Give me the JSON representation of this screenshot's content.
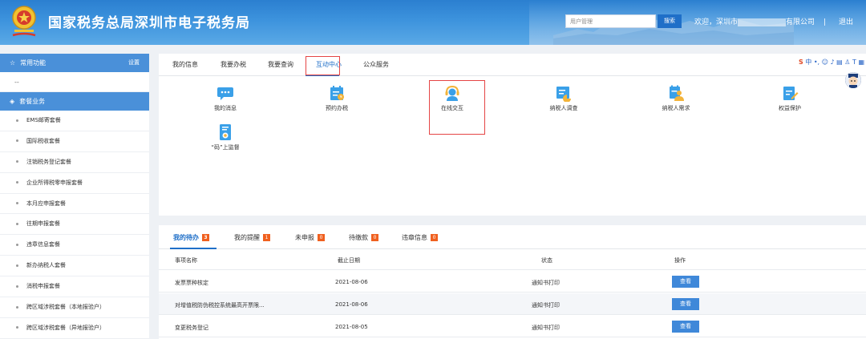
{
  "header": {
    "site_title": "国家税务总局深圳市电子税务局",
    "search_placeholder": "用户管理",
    "search_button": "搜索",
    "welcome_prefix": "欢迎，深圳市",
    "welcome_suffix": "有限公司",
    "separator": "|",
    "logout": "退出"
  },
  "sidebar": {
    "common_title": "常用功能",
    "settings": "设置",
    "placeholder": "--",
    "package_title": "套餐业务",
    "items": [
      "EMS邮寄套餐",
      "国际税收套餐",
      "注销税务登记套餐",
      "企业所得税零申报套餐",
      "本月应申报套餐",
      "往期申报套餐",
      "违章信息套餐",
      "新办纳税人套餐",
      "消税申报套餐",
      "跨区域涉税套餐（本地报验户）",
      "跨区域涉税套餐（异地报验户）"
    ]
  },
  "tabs": [
    {
      "label": "我的信息"
    },
    {
      "label": "我要办税"
    },
    {
      "label": "我要查询"
    },
    {
      "label": "互动中心",
      "active": true
    },
    {
      "label": "公众服务"
    }
  ],
  "functions": [
    {
      "label": "我的消息",
      "icon": "message-icon"
    },
    {
      "label": "预约办税",
      "icon": "calendar-icon"
    },
    {
      "label": "在线交互",
      "icon": "customer-service-icon"
    },
    {
      "label": "纳税人调查",
      "icon": "survey-chart-icon"
    },
    {
      "label": "纳税人需求",
      "icon": "taxpayer-demand-icon"
    },
    {
      "label": "权益保护",
      "icon": "rights-protection-icon"
    },
    {
      "label": "“码”上监督",
      "icon": "qr-supervision-icon"
    }
  ],
  "bottom_tabs": [
    {
      "label": "我的待办",
      "count": "3",
      "active": true
    },
    {
      "label": "我的提醒",
      "count": "1"
    },
    {
      "label": "未申报",
      "count": "0"
    },
    {
      "label": "待缴款",
      "count": "0"
    },
    {
      "label": "违章信息",
      "count": "0"
    }
  ],
  "table": {
    "headers": [
      "事项名称",
      "截止日期",
      "状态",
      "操作"
    ],
    "rows": [
      {
        "name": "发票票种核定",
        "date": "2021-08-06",
        "status": "通知书打印",
        "action": "查看"
      },
      {
        "name": "对增值税防伪税控系统最高开票限...",
        "date": "2021-08-06",
        "status": "通知书打印",
        "action": "查看"
      },
      {
        "name": "变更税务登记",
        "date": "2021-08-05",
        "status": "通知书打印",
        "action": "查看"
      }
    ]
  },
  "colors": {
    "header_blue": "#3d93dd",
    "sidebar_blue": "#4a90d9",
    "accent_blue": "#1f6fc8",
    "highlight_red": "#e54545",
    "badge_orange": "#f0601f"
  }
}
